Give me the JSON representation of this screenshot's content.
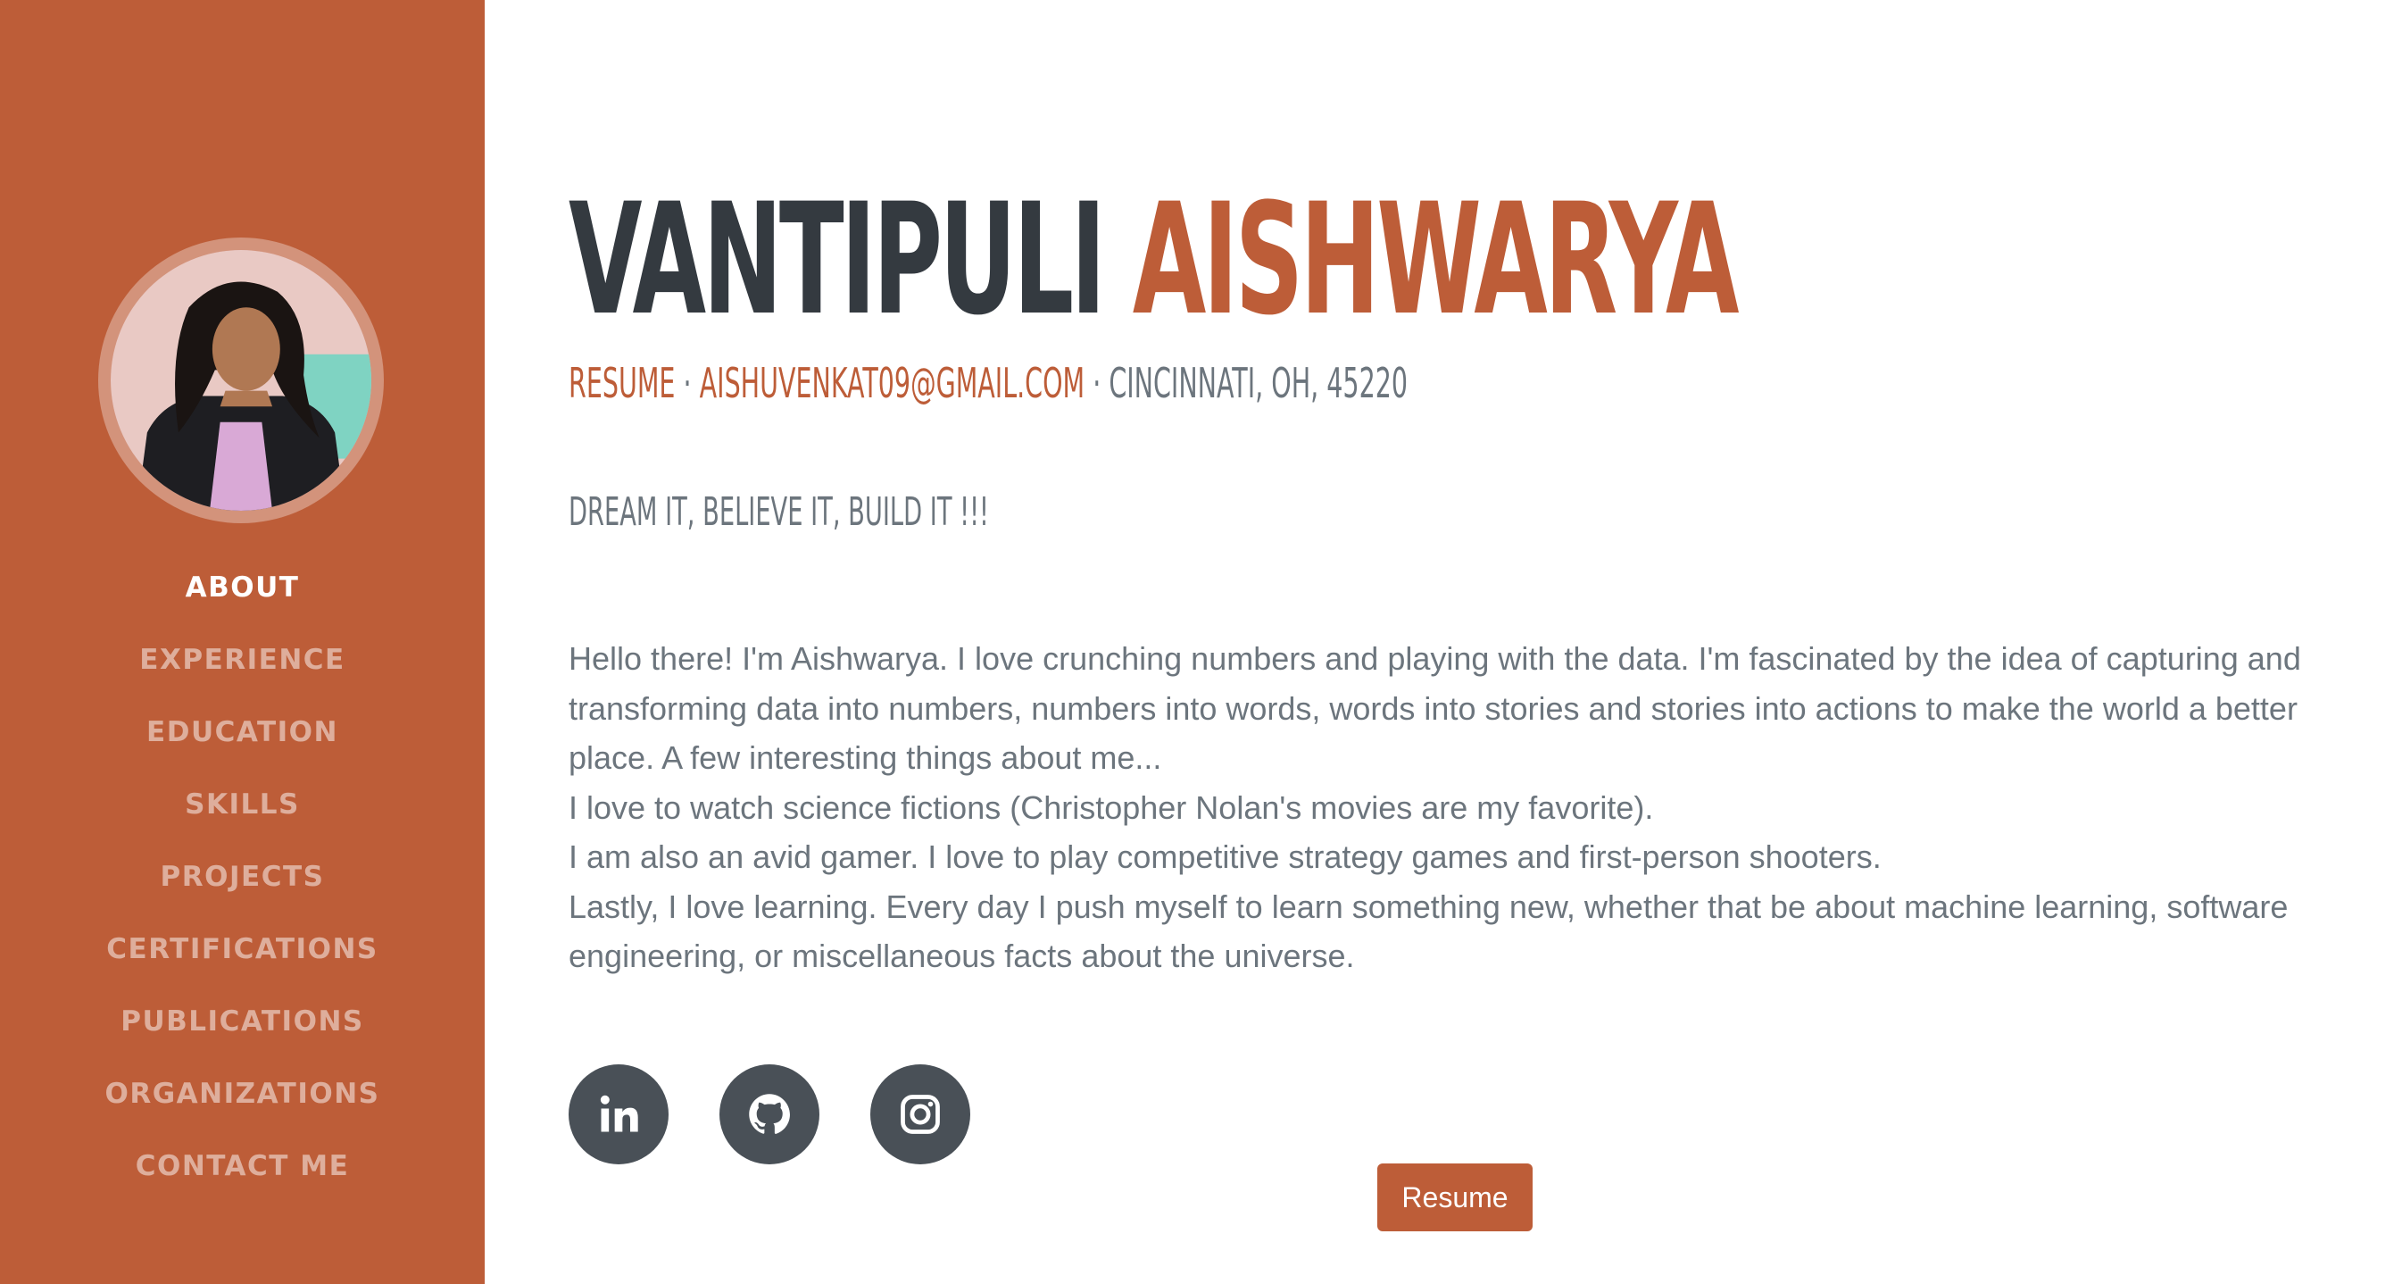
{
  "sidebar": {
    "nav": [
      {
        "label": "ABOUT",
        "active": true
      },
      {
        "label": "EXPERIENCE",
        "active": false
      },
      {
        "label": "EDUCATION",
        "active": false
      },
      {
        "label": "SKILLS",
        "active": false
      },
      {
        "label": "PROJECTS",
        "active": false
      },
      {
        "label": "CERTIFICATIONS",
        "active": false
      },
      {
        "label": "PUBLICATIONS",
        "active": false
      },
      {
        "label": "ORGANIZATIONS",
        "active": false
      },
      {
        "label": "CONTACT ME",
        "active": false
      }
    ]
  },
  "header": {
    "first_name": "VANTIPULI",
    "last_name": "AISHWARYA",
    "resume_link": "RESUME",
    "separator": " · ",
    "email": "AISHUVENKAT09@GMAIL.COM",
    "location": "CINCINNATI, OH, 45220"
  },
  "tagline": "DREAM IT, BELIEVE IT, BUILD IT !!!",
  "bio": [
    "Hello there! I'm Aishwarya. I love crunching numbers and playing with the data. I'm fascinated by the idea of capturing and transforming data into numbers, numbers into words, words into stories and stories into actions to make the world a better place. A few interesting things about me...",
    "I love to watch science fictions (Christopher Nolan's movies are my favorite).",
    "I am also an avid gamer. I love to play competitive strategy games and first-person shooters.",
    "Lastly, I love learning. Every day I push myself to learn something new, whether that be about machine learning, software engineering, or miscellaneous facts about the universe."
  ],
  "social": [
    {
      "icon": "linkedin-icon"
    },
    {
      "icon": "github-icon"
    },
    {
      "icon": "instagram-icon"
    }
  ],
  "resume_button": "Resume",
  "colors": {
    "accent": "#bd5d38",
    "dark": "#343a40",
    "muted": "#6c757d",
    "social_bg": "#495057"
  }
}
